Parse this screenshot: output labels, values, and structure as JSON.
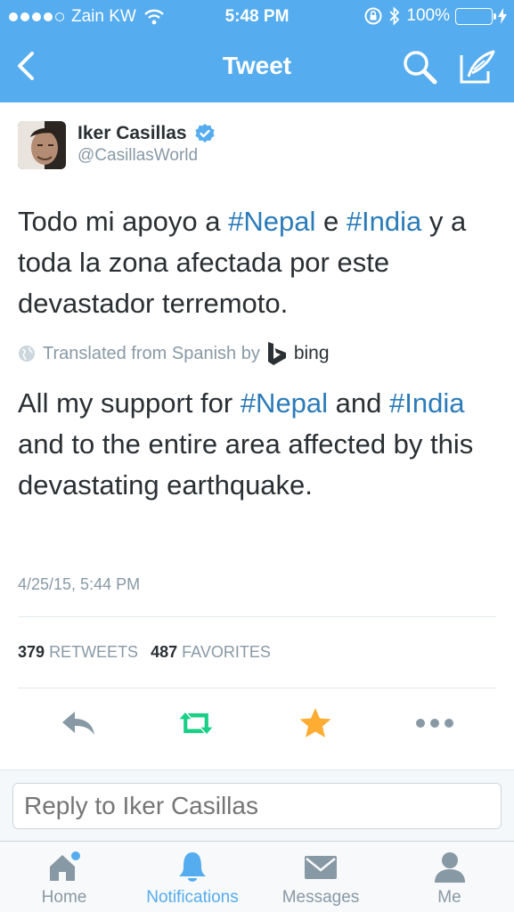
{
  "status_bar": {
    "carrier": "Zain KW",
    "time": "5:48 PM",
    "battery": "100%"
  },
  "nav": {
    "title": "Tweet"
  },
  "tweet": {
    "author_name": "Iker Casillas",
    "author_handle": "@CasillasWorld",
    "text_parts": {
      "p1": "Todo mi apoyo a ",
      "h1": "#Nepal",
      "p2": " e ",
      "h2": "#India",
      "p3": " y a toda la zona afectada por este devastador terremoto."
    },
    "translated_label": "Translated from Spanish by",
    "translator": "bing",
    "translation_parts": {
      "p1": "All my support for ",
      "h1": "#Nepal",
      "p2": " and ",
      "h2": "#India",
      "p3": " and to the entire area affected by this devastating earthquake."
    },
    "timestamp": "4/25/15, 5:44 PM",
    "retweets_count": "379",
    "retweets_label": "RETWEETS",
    "favorites_count": "487",
    "favorites_label": "FAVORITES"
  },
  "reply": {
    "placeholder": "Reply to Iker Casillas"
  },
  "tabbar": {
    "items": [
      {
        "label": "Home"
      },
      {
        "label": "Notifications"
      },
      {
        "label": "Messages"
      },
      {
        "label": "Me"
      }
    ]
  },
  "colors": {
    "brand": "#55acee",
    "hashtag": "#2b7bb9",
    "retweet_green": "#19cf86",
    "favorite_orange": "#ffac33"
  }
}
